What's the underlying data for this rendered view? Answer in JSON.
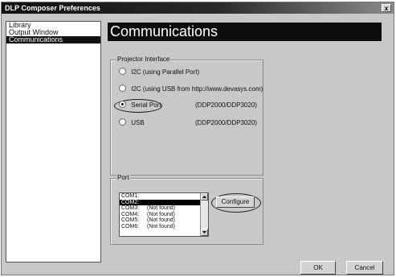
{
  "window": {
    "title": "DLP Composer Preferences",
    "close_glyph": "x"
  },
  "nav": {
    "items": [
      "Library",
      "Output Window",
      "Communications"
    ],
    "selected_index": 2
  },
  "page": {
    "heading": "Communications"
  },
  "projector_interface": {
    "label": "Projector Interface",
    "options": [
      {
        "label": "I2C (using Parallel Port)",
        "note": "",
        "checked": false
      },
      {
        "label": "I2C (using USB from http://www.devasys.com)",
        "note": "",
        "checked": false
      },
      {
        "label": "Serial Port",
        "note": "(DDP2000/DDP3020)",
        "checked": true
      },
      {
        "label": "USB",
        "note": "(DDP2000/DDP3020)",
        "checked": false
      }
    ]
  },
  "port": {
    "label": "Port",
    "items": [
      {
        "name": "COM1:",
        "status": ""
      },
      {
        "name": "COM2:",
        "status": ""
      },
      {
        "name": "COM3:",
        "status": "(Not found)"
      },
      {
        "name": "COM4:",
        "status": "(Not found)"
      },
      {
        "name": "COM5:",
        "status": "(Not found)"
      },
      {
        "name": "COM6:",
        "status": "(Not found)"
      }
    ],
    "selected": "COM2:",
    "configure_label": "Configure"
  },
  "footer": {
    "ok_label": "OK",
    "cancel_label": "Cancel"
  },
  "icons": {
    "scroll_up": "triangle-up",
    "scroll_down": "triangle-down"
  }
}
